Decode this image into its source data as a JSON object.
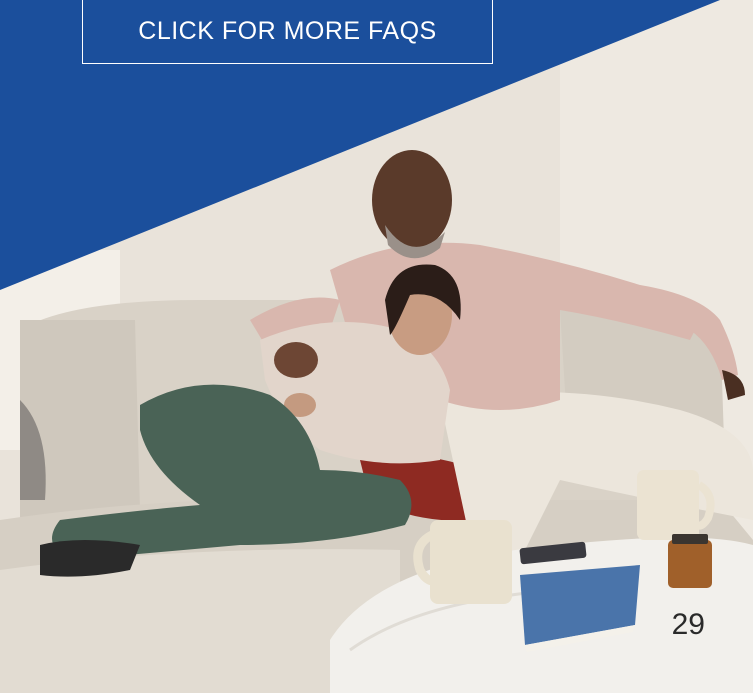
{
  "cta": {
    "label": "CLICK FOR MORE FAQS"
  },
  "page": {
    "number": "29"
  },
  "colors": {
    "brand_blue": "#1b4f9c",
    "button_text": "#ffffff",
    "page_number": "#2a2a2a"
  },
  "photo": {
    "icon": "lifestyle-photo"
  }
}
